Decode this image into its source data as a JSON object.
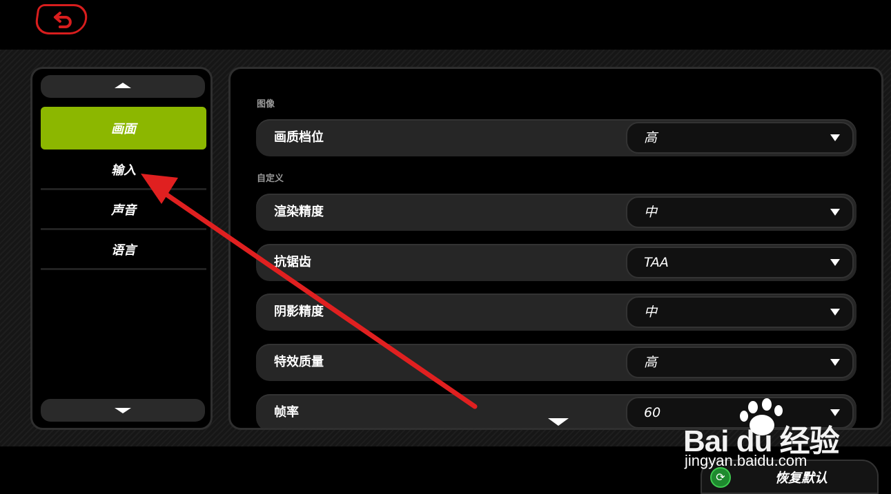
{
  "header": {
    "back_icon": "back-arrow-icon"
  },
  "sidebar": {
    "items": [
      {
        "label": "画面",
        "active": true
      },
      {
        "label": "输入",
        "active": false
      },
      {
        "label": "声音",
        "active": false
      },
      {
        "label": "语言",
        "active": false
      }
    ]
  },
  "settings": {
    "section_image": "图像",
    "section_custom": "自定义",
    "rows": [
      {
        "label": "画质档位",
        "value": "高"
      },
      {
        "label": "渲染精度",
        "value": "中"
      },
      {
        "label": "抗锯齿",
        "value": "TAA"
      },
      {
        "label": "阴影精度",
        "value": "中"
      },
      {
        "label": "特效质量",
        "value": "高"
      },
      {
        "label": "帧率",
        "value": "60"
      }
    ]
  },
  "footer": {
    "restore_label": "恢复默认"
  },
  "watermark": {
    "main": "Bai du 经验",
    "sub": "jingyan.baidu.com"
  },
  "colors": {
    "accent": "#8cb700",
    "back_border": "#d81d1d",
    "arrow": "#e02020"
  }
}
